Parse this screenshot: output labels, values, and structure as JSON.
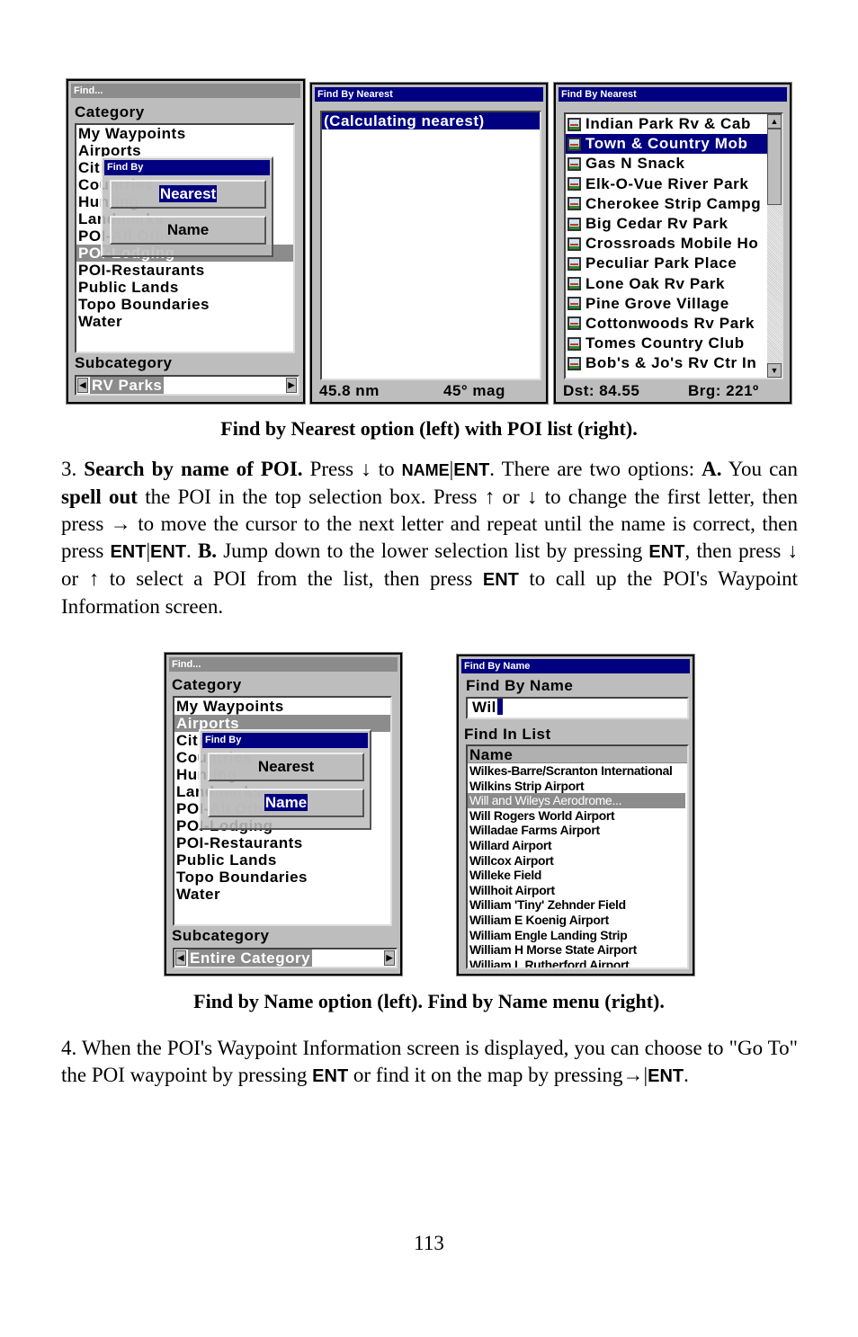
{
  "screen_find_nearest": {
    "title": "Find...",
    "category_label": "Category",
    "categories": [
      "My Waypoints",
      "Airports",
      "Cities",
      "Countries",
      "Hunting",
      "Landmarks",
      "POI-All Others",
      "POI-Lodging",
      "POI-Restaurants",
      "Public Lands",
      "Topo Boundaries",
      "Water"
    ],
    "selected_index": 7,
    "popup_title": "Find By",
    "popup_options": [
      "Nearest",
      "Name"
    ],
    "popup_selected": "Nearest",
    "subcategory_label": "Subcategory",
    "subcategory_value": "RV Parks"
  },
  "screen_calculating": {
    "title": "Find By Nearest",
    "status": "(Calculating nearest)",
    "distance": "45.8 nm",
    "bearing": "45° mag"
  },
  "screen_poi_list": {
    "title": "Find By Nearest",
    "items": [
      "Indian Park Rv & Cab",
      "Town & Country Mob",
      "Gas N Snack",
      "Elk-O-Vue River Park",
      "Cherokee Strip Campg",
      "Big Cedar Rv Park",
      "Crossroads Mobile Ho",
      "Peculiar Park Place",
      "Lone Oak Rv Park",
      "Pine Grove Village",
      "Cottonwoods Rv Park",
      "Tomes Country Club",
      "Bob's & Jo's Rv Ctr In"
    ],
    "selected_index": 1,
    "icon": "poi-rv-park-icon",
    "dst": "Dst: 84.55",
    "brg": "Brg: 221º"
  },
  "caption1": "Find by Nearest option (left) with POI list (right).",
  "para3": [
    {
      "t": "3. ",
      "s": ""
    },
    {
      "t": "Search by name of POI.",
      "s": "b"
    },
    {
      "t": " Press ↓ to ",
      "s": ""
    },
    {
      "t": "NAME",
      "s": "sc"
    },
    {
      "t": "|",
      "s": ""
    },
    {
      "t": "ENT",
      "s": "k"
    },
    {
      "t": ". There are two options: ",
      "s": ""
    },
    {
      "t": "A.",
      "s": "b"
    },
    {
      "t": " You can ",
      "s": ""
    },
    {
      "t": "spell out",
      "s": "b"
    },
    {
      "t": " the POI in the top selection box. Press ↑ or ↓ to change the first letter, then press → to move the cursor to the next letter and repeat until the name is correct, then press ",
      "s": ""
    },
    {
      "t": "ENT",
      "s": "k"
    },
    {
      "t": "|",
      "s": ""
    },
    {
      "t": "ENT",
      "s": "k"
    },
    {
      "t": ". ",
      "s": ""
    },
    {
      "t": "B.",
      "s": "b"
    },
    {
      "t": " Jump down to the lower selection list by pressing ",
      "s": ""
    },
    {
      "t": "ENT",
      "s": "k"
    },
    {
      "t": ", then press ↓ or ↑ to select a POI from the list, then press ",
      "s": ""
    },
    {
      "t": "ENT",
      "s": "k"
    },
    {
      "t": " to call up the POI's Waypoint Information screen.",
      "s": ""
    }
  ],
  "screen_find_name": {
    "title": "Find...",
    "category_label": "Category",
    "categories": [
      "My Waypoints",
      "Airports",
      "Cities",
      "Countries",
      "Hunting",
      "Landmarks",
      "POI-All Others",
      "POI-Lodging",
      "POI-Restaurants",
      "Public Lands",
      "Topo Boundaries",
      "Water"
    ],
    "selected_index": 1,
    "popup_title": "Find By",
    "popup_options": [
      "Nearest",
      "Name"
    ],
    "popup_selected": "Name",
    "subcategory_label": "Subcategory",
    "subcategory_value": "Entire Category"
  },
  "screen_name_menu": {
    "title": "Find By Name",
    "find_label": "Find By Name",
    "input_value": "Wil",
    "list_label": "Find In List",
    "column_header": "Name",
    "items": [
      "Wilkes-Barre/Scranton International",
      "Wilkins Strip Airport",
      "Will and Wileys Aerodrome...",
      "Will Rogers World Airport",
      "Willadae Farms Airport",
      "Willard Airport",
      "Willcox Airport",
      "Willeke Field",
      "Willhoit Airport",
      "William 'Tiny' Zehnder Field",
      "William E Koenig Airport",
      "William Engle Landing Strip",
      "William H Morse State Airport",
      "William L Rutherford Airport"
    ],
    "selected_index": 2
  },
  "caption2": "Find by Name option (left). Find by Name menu (right).",
  "para4": [
    {
      "t": "4. When the POI's Waypoint Information screen is displayed, you can choose to \"Go To\" the POI waypoint by pressing ",
      "s": ""
    },
    {
      "t": "ENT",
      "s": "k"
    },
    {
      "t": " or find it on the map by pressing→|",
      "s": ""
    },
    {
      "t": "ENT",
      "s": "k"
    },
    {
      "t": ".",
      "s": ""
    }
  ],
  "page_number": "113"
}
